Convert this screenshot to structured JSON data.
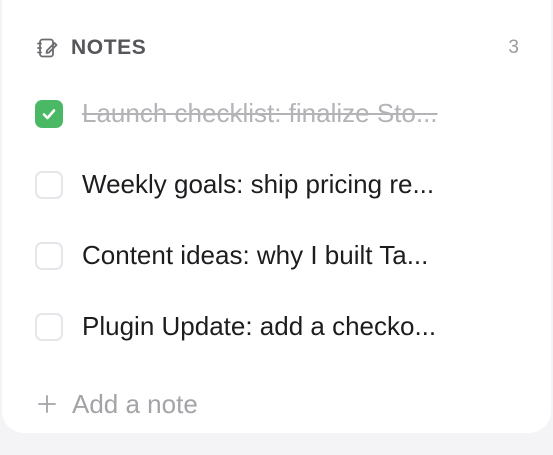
{
  "header": {
    "icon": "notebook-pen-icon",
    "title": "NOTES",
    "count": "3"
  },
  "notes": [
    {
      "text": "Launch checklist: finalize Sto...",
      "done": true
    },
    {
      "text": "Weekly goals: ship pricing re...",
      "done": false
    },
    {
      "text": "Content ideas: why I built Ta...",
      "done": false
    },
    {
      "text": "Plugin Update: add a checko...",
      "done": false
    }
  ],
  "add_note": {
    "icon": "plus-icon",
    "label": "Add a note"
  },
  "colors": {
    "check_green": "#4bb866",
    "done_text": "#b3b3b8",
    "text": "#1d1d20"
  }
}
